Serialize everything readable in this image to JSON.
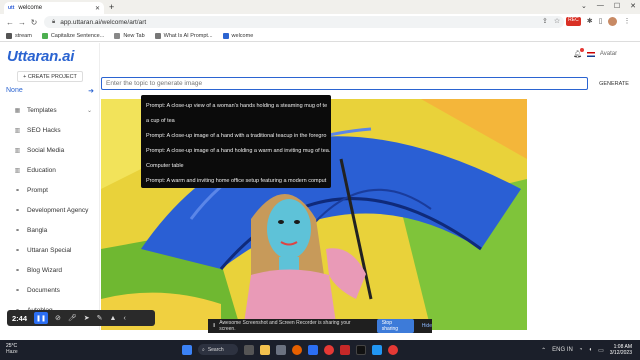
{
  "browser": {
    "tab_title": "welcome",
    "tab_favicon": "utt",
    "url": "app.uttaran.ai/welcome/art/art",
    "bookmarks": [
      "stream",
      "Capitalize Sentence...",
      "New Tab",
      "What Is AI Prompt...",
      "welcome"
    ]
  },
  "app": {
    "logo": "Uttaran.ai",
    "create_project": "+ CREATE PROJECT",
    "project_selected": "None",
    "nav": [
      {
        "label": "Templates",
        "icon": "grid-icon",
        "chevron": true
      },
      {
        "label": "SEO Hacks",
        "icon": "chart-icon"
      },
      {
        "label": "Social Media",
        "icon": "chart-icon"
      },
      {
        "label": "Education",
        "icon": "chart-icon"
      },
      {
        "label": "Prompt",
        "icon": "link-icon"
      },
      {
        "label": "Development Agency",
        "icon": "link-icon"
      },
      {
        "label": "Bangla",
        "icon": "link-icon"
      },
      {
        "label": "Uttaran Special",
        "icon": "link-icon"
      },
      {
        "label": "Blog Wizard",
        "icon": "link-icon"
      },
      {
        "label": "Documents",
        "icon": "link-icon"
      },
      {
        "label": "Autoblog",
        "icon": "link-icon",
        "chevron": true
      }
    ],
    "avatar_alt": "Avatar",
    "search_placeholder": "Enter the topic to generate image",
    "generate_label": "GENERATE",
    "suggestions": [
      "Prompt: A close-up view of a woman's hands holding a steaming mug of te",
      "a cup of tea",
      "Prompt: A close-up image of a hand with a traditional teacup in the foregro",
      "Prompt: A close-up image of a hand holding a warm and inviting mug of tea. The r",
      "Computer table",
      "Prompt: A warm and inviting home office setup featuring a modern comput"
    ]
  },
  "recorder": {
    "time": "2:44",
    "share_message": "Awesome Screenshot and Screen Recorder is sharing your screen.",
    "stop_label": "Stop sharing",
    "hide_label": "Hide"
  },
  "taskbar": {
    "temp": "25°C",
    "weather": "Haze",
    "search_label": "Search",
    "time": "1:08 AM",
    "date": "3/12/2023",
    "lang": "ENG IN"
  },
  "colors": {
    "accent": "#2b64d1",
    "taskbar": "#1b1f2a",
    "dropdown": "#0b0b0b"
  }
}
